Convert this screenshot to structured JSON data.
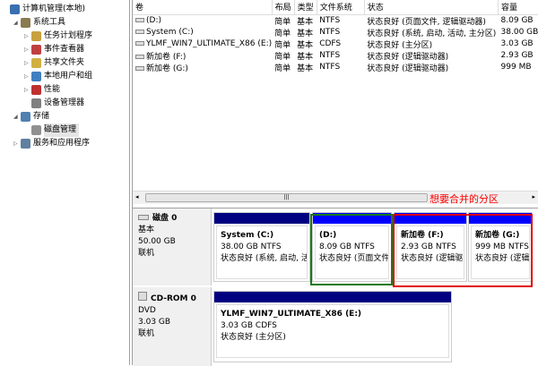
{
  "tree": [
    {
      "label": "计算机管理(本地)",
      "level": 0,
      "color": "#3a6fb0"
    },
    {
      "label": "系统工具",
      "level": 1,
      "color": "#8a7a50",
      "expanded": true
    },
    {
      "label": "任务计划程序",
      "level": 2,
      "color": "#c9a040",
      "collapsed": true
    },
    {
      "label": "事件查看器",
      "level": 2,
      "color": "#c04040",
      "collapsed": true
    },
    {
      "label": "共享文件夹",
      "level": 2,
      "color": "#d0b040",
      "collapsed": true
    },
    {
      "label": "本地用户和组",
      "level": 2,
      "color": "#4080c0",
      "collapsed": true
    },
    {
      "label": "性能",
      "level": 2,
      "color": "#c03030",
      "collapsed": true
    },
    {
      "label": "设备管理器",
      "level": 2,
      "color": "#808080"
    },
    {
      "label": "存储",
      "level": 1,
      "color": "#5080b0",
      "expanded": true
    },
    {
      "label": "磁盘管理",
      "level": 2,
      "color": "#909090",
      "selected": true
    },
    {
      "label": "服务和应用程序",
      "level": 1,
      "color": "#6080a0",
      "collapsed": true
    }
  ],
  "table": {
    "columns": [
      "卷",
      "布局",
      "类型",
      "文件系统",
      "状态",
      "容量"
    ],
    "rows": [
      [
        "(D:)",
        "简单",
        "基本",
        "NTFS",
        "状态良好 (页面文件, 逻辑驱动器)",
        "8.09 GB"
      ],
      [
        "System (C:)",
        "简单",
        "基本",
        "NTFS",
        "状态良好 (系统, 启动, 活动, 主分区)",
        "38.00 GB"
      ],
      [
        "YLMF_WIN7_ULTIMATE_X86 (E:)",
        "简单",
        "基本",
        "CDFS",
        "状态良好 (主分区)",
        "3.03 GB"
      ],
      [
        "新加卷 (F:)",
        "简单",
        "基本",
        "NTFS",
        "状态良好 (逻辑驱动器)",
        "2.93 GB"
      ],
      [
        "新加卷 (G:)",
        "简单",
        "基本",
        "NTFS",
        "状态良好 (逻辑驱动器)",
        "999 MB"
      ]
    ]
  },
  "annotation": "想要合并的分区",
  "disk0": {
    "name": "磁盘 0",
    "type": "基本",
    "size": "50.00 GB",
    "status": "联机",
    "partitions": [
      {
        "name": "System  (C:)",
        "size": "38.00 GB NTFS",
        "status": "状态良好 (系统, 启动, 活",
        "color": "#000080"
      },
      {
        "name": "  (D:)",
        "size": "8.09 GB NTFS",
        "status": "状态良好 (页面文件",
        "color": "#0000ff"
      },
      {
        "name": "新加卷  (F:)",
        "size": "2.93 GB NTFS",
        "status": "状态良好 (逻辑驱",
        "color": "#0000ff"
      },
      {
        "name": "新加卷  (G:)",
        "size": "999 MB NTFS",
        "status": "状态良好 (逻辑",
        "color": "#0000ff"
      }
    ]
  },
  "cdrom0": {
    "name": "CD-ROM 0",
    "type": "DVD",
    "size": "3.03 GB",
    "status": "联机",
    "partition": {
      "name": "YLMF_WIN7_ULTIMATE_X86  (E:)",
      "size": "3.03 GB CDFS",
      "status": "状态良好 (主分区)",
      "color": "#000080"
    }
  },
  "highlight_colors": {
    "green": "#1a7a1a",
    "red": "#e00000"
  }
}
